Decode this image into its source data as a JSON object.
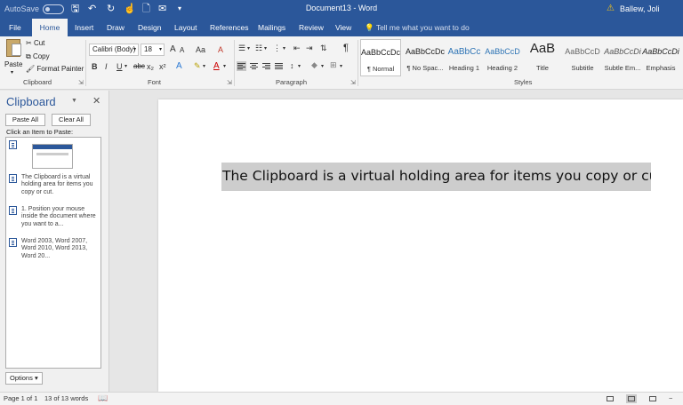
{
  "titlebar": {
    "autosave": "AutoSave",
    "autosave_state": "Off",
    "title": "Document13 - Word",
    "user": "Ballew, Joli"
  },
  "tabs": [
    {
      "label": "File"
    },
    {
      "label": "Home"
    },
    {
      "label": "Insert"
    },
    {
      "label": "Draw"
    },
    {
      "label": "Design"
    },
    {
      "label": "Layout"
    },
    {
      "label": "References"
    },
    {
      "label": "Mailings"
    },
    {
      "label": "Review"
    },
    {
      "label": "View"
    }
  ],
  "active_tab": "Home",
  "tell_me": "Tell me what you want to do",
  "ribbon": {
    "clipboard": {
      "paste": "Paste",
      "cut": "Cut",
      "copy": "Copy",
      "format_painter": "Format Painter",
      "group_label": "Clipboard"
    },
    "font": {
      "font_name": "Calibri (Body)",
      "font_size": "18",
      "group_label": "Font",
      "bold": "B",
      "italic": "I",
      "underline": "U",
      "strike": "abc",
      "subscript": "x₂",
      "superscript": "x²",
      "grow": "A",
      "shrink": "A",
      "change_case": "Aa",
      "clear_format": "A",
      "text_effects": "A",
      "font_color": "A"
    },
    "paragraph": {
      "group_label": "Paragraph",
      "pilcrow": "¶"
    },
    "styles": {
      "group_label": "Styles",
      "items": [
        {
          "sample": "AaBbCcDc",
          "name": "¶ Normal"
        },
        {
          "sample": "AaBbCcDc",
          "name": "¶ No Spac..."
        },
        {
          "sample": "AaBbCc",
          "name": "Heading 1"
        },
        {
          "sample": "AaBbCcD",
          "name": "Heading 2"
        },
        {
          "sample": "AaB",
          "name": "Title"
        },
        {
          "sample": "AaBbCcD",
          "name": "Subtitle"
        },
        {
          "sample": "AaBbCcDi",
          "name": "Subtle Em..."
        },
        {
          "sample": "AaBbCcDi",
          "name": "Emphasis"
        }
      ]
    }
  },
  "clipboard_pane": {
    "title": "Clipboard",
    "paste_all": "Paste All",
    "clear_all": "Clear All",
    "hint": "Click an Item to Paste:",
    "items": [
      {
        "text": ""
      },
      {
        "text": "The Clipboard is a virtual holding area for items you copy or cut."
      },
      {
        "text": "1. Position your mouse inside the document where you want to a..."
      },
      {
        "text": "Word 2003, Word 2007, Word 2010, Word 2013, Word 20..."
      }
    ],
    "options": "Options"
  },
  "document": {
    "selected_text": "The Clipboard is a virtual holding area for items you copy or cut."
  },
  "statusbar": {
    "page": "Page 1 of 1",
    "words": "13 of 13 words"
  },
  "colors": {
    "brand": "#2b579a",
    "ribbon_bg": "#f3f3f3",
    "selection": "#cdcdcd"
  }
}
